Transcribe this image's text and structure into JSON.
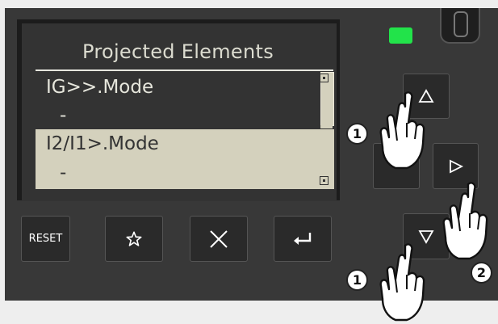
{
  "screen": {
    "title": "Projected Elements",
    "rows": [
      {
        "text": "IG>>.Mode",
        "selected": false
      },
      {
        "text": "-",
        "selected": false
      },
      {
        "text": "I2/I1>.Mode",
        "selected": true
      },
      {
        "text": "-",
        "selected": true
      }
    ]
  },
  "keys": {
    "reset_label": "RESET",
    "favorite_icon": "star-icon",
    "cancel_icon": "close-icon",
    "enter_icon": "enter-icon",
    "up_icon": "triangle-up-icon",
    "right_icon": "triangle-right-icon",
    "down_icon": "triangle-down-icon"
  },
  "annotations": [
    {
      "label": "1"
    },
    {
      "label": "2"
    },
    {
      "label": "1"
    }
  ],
  "colors": {
    "panel": "#383838",
    "lcd_background": "#333333",
    "lcd_text": "#e6e6dc",
    "selection": "#d4d1bd",
    "led": "#22e34a"
  }
}
